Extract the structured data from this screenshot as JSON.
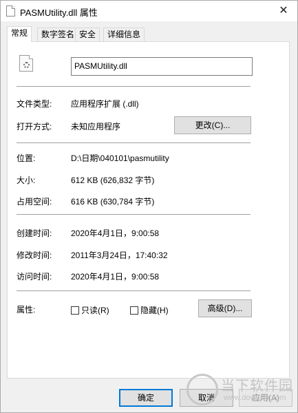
{
  "window": {
    "title": "PASMUtility.dll 属性",
    "close_glyph": "✕"
  },
  "tabs": [
    {
      "label": "常规",
      "active": true
    },
    {
      "label": "数字签名",
      "active": false
    },
    {
      "label": "安全",
      "active": false
    },
    {
      "label": "详细信息",
      "active": false
    }
  ],
  "file": {
    "name": "PASMUtility.dll",
    "icon": "dll-file-icon"
  },
  "info": {
    "type_label": "文件类型:",
    "type_value": "应用程序扩展 (.dll)",
    "open_label": "打开方式:",
    "open_value": "未知应用程序",
    "change_button": "更改(C)...",
    "location_label": "位置:",
    "location_value": "D:\\日期\\040101\\pasmutility",
    "size_label": "大小:",
    "size_value": "612 KB (626,832 字节)",
    "disk_label": "占用空间:",
    "disk_value": "616 KB (630,784 字节)",
    "created_label": "创建时间:",
    "created_value": "2020年4月1日，9:00:58",
    "modified_label": "修改时间:",
    "modified_value": "2011年3月24日，17:40:32",
    "accessed_label": "访问时间:",
    "accessed_value": "2020年4月1日，9:00:58",
    "attr_label": "属性:",
    "readonly_label": "只读(R)",
    "hidden_label": "隐藏(H)",
    "advanced_button": "高级(D)..."
  },
  "buttons": {
    "ok": "确定",
    "cancel": "取消",
    "apply": "应用(A)"
  },
  "watermark": {
    "text": "当下软件园",
    "url": "www.downxia.com"
  }
}
